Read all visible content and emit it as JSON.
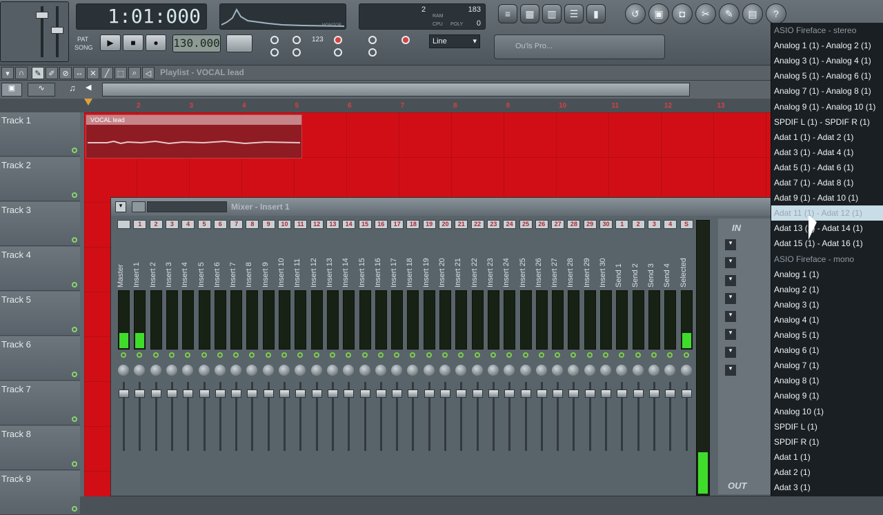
{
  "toolbar": {
    "song_time": "1:01:000",
    "tempo": "130.000",
    "memory": "2",
    "poly": "183",
    "cpu": "0",
    "cpu_label": "CPU",
    "poly_label": "POLY",
    "ram_label": "RAM",
    "monitor_label": "MONITOR",
    "pat_label": "PAT",
    "song_label": "SONG",
    "line_mode": "Line",
    "hint_bar": "Ou'ls Pro...",
    "pattern_counter": "123"
  },
  "playlist": {
    "title": "Playlist - VOCAL lead",
    "ruler": [
      "2",
      "3",
      "4",
      "5",
      "6",
      "7",
      "8",
      "9",
      "10",
      "11",
      "12",
      "13"
    ],
    "clip_name": "VOCAL lead",
    "tracks": [
      "Track 1",
      "Track 2",
      "Track 3",
      "Track 4",
      "Track 5",
      "Track 6",
      "Track 7",
      "Track 8",
      "Track 9"
    ]
  },
  "mixer": {
    "title": "Mixer - Insert 1",
    "strips": [
      {
        "num": "",
        "name": "Master"
      },
      {
        "num": "1",
        "name": "Insert 1"
      },
      {
        "num": "2",
        "name": "Insert 2"
      },
      {
        "num": "3",
        "name": "Insert 3"
      },
      {
        "num": "4",
        "name": "Insert 4"
      },
      {
        "num": "5",
        "name": "Insert 5"
      },
      {
        "num": "6",
        "name": "Insert 6"
      },
      {
        "num": "7",
        "name": "Insert 7"
      },
      {
        "num": "8",
        "name": "Insert 8"
      },
      {
        "num": "9",
        "name": "Insert 9"
      },
      {
        "num": "10",
        "name": "Insert 10"
      },
      {
        "num": "11",
        "name": "Insert 11"
      },
      {
        "num": "12",
        "name": "Insert 12"
      },
      {
        "num": "13",
        "name": "Insert 13"
      },
      {
        "num": "14",
        "name": "Insert 14"
      },
      {
        "num": "15",
        "name": "Insert 15"
      },
      {
        "num": "16",
        "name": "Insert 16"
      },
      {
        "num": "17",
        "name": "Insert 17"
      },
      {
        "num": "18",
        "name": "Insert 18"
      },
      {
        "num": "19",
        "name": "Insert 19"
      },
      {
        "num": "20",
        "name": "Insert 20"
      },
      {
        "num": "21",
        "name": "Insert 21"
      },
      {
        "num": "22",
        "name": "Insert 22"
      },
      {
        "num": "23",
        "name": "Insert 23"
      },
      {
        "num": "24",
        "name": "Insert 24"
      },
      {
        "num": "25",
        "name": "Insert 25"
      },
      {
        "num": "26",
        "name": "Insert 26"
      },
      {
        "num": "27",
        "name": "Insert 27"
      },
      {
        "num": "28",
        "name": "Insert 28"
      },
      {
        "num": "29",
        "name": "Insert 29"
      },
      {
        "num": "30",
        "name": "Insert 30"
      },
      {
        "num": "1",
        "name": "Send 1"
      },
      {
        "num": "2",
        "name": "Send 2"
      },
      {
        "num": "3",
        "name": "Send 3"
      },
      {
        "num": "4",
        "name": "Send 4"
      },
      {
        "num": "S",
        "name": "Selected"
      }
    ],
    "in_label": "IN",
    "out_label": "OUT"
  },
  "menu": {
    "items": [
      {
        "label": "ASIO Fireface - stereo",
        "type": "header"
      },
      {
        "label": "Analog 1 (1) - Analog 2 (1)",
        "type": "item"
      },
      {
        "label": "Analog 3 (1) - Analog 4 (1)",
        "type": "item"
      },
      {
        "label": "Analog 5 (1) - Analog 6 (1)",
        "type": "item"
      },
      {
        "label": "Analog 7 (1) - Analog 8 (1)",
        "type": "item"
      },
      {
        "label": "Analog 9 (1) - Analog 10 (1)",
        "type": "item"
      },
      {
        "label": "SPDIF L (1) - SPDIF R (1)",
        "type": "item"
      },
      {
        "label": "Adat 1 (1) - Adat 2 (1)",
        "type": "item"
      },
      {
        "label": "Adat 3 (1) - Adat 4 (1)",
        "type": "item"
      },
      {
        "label": "Adat 5 (1) - Adat 6 (1)",
        "type": "item"
      },
      {
        "label": "Adat 7 (1) - Adat 8 (1)",
        "type": "item"
      },
      {
        "label": "Adat 9 (1) - Adat 10 (1)",
        "type": "item"
      },
      {
        "label": "Adat 11 (1) - Adat 12 (1)",
        "type": "selected"
      },
      {
        "label": "Adat 13 (1) - Adat 14 (1)",
        "type": "item"
      },
      {
        "label": "Adat 15 (1) - Adat 16 (1)",
        "type": "item"
      },
      {
        "label": "ASIO Fireface - mono",
        "type": "header"
      },
      {
        "label": "Analog 1 (1)",
        "type": "item"
      },
      {
        "label": "Analog 2 (1)",
        "type": "item"
      },
      {
        "label": "Analog 3 (1)",
        "type": "item"
      },
      {
        "label": "Analog 4 (1)",
        "type": "item"
      },
      {
        "label": "Analog 5 (1)",
        "type": "item"
      },
      {
        "label": "Analog 6 (1)",
        "type": "item"
      },
      {
        "label": "Analog 7 (1)",
        "type": "item"
      },
      {
        "label": "Analog 8 (1)",
        "type": "item"
      },
      {
        "label": "Analog 9 (1)",
        "type": "item"
      },
      {
        "label": "Analog 10 (1)",
        "type": "item"
      },
      {
        "label": "SPDIF L (1)",
        "type": "item"
      },
      {
        "label": "SPDIF R (1)",
        "type": "item"
      },
      {
        "label": "Adat 1 (1)",
        "type": "item"
      },
      {
        "label": "Adat 2 (1)",
        "type": "item"
      },
      {
        "label": "Adat 3 (1)",
        "type": "item"
      }
    ]
  },
  "colors": {
    "playlist_bg": "#d10e16",
    "accent_red": "#d94040",
    "meter_green": "#3fdc2c",
    "menu_bg": "#1a1f23"
  }
}
